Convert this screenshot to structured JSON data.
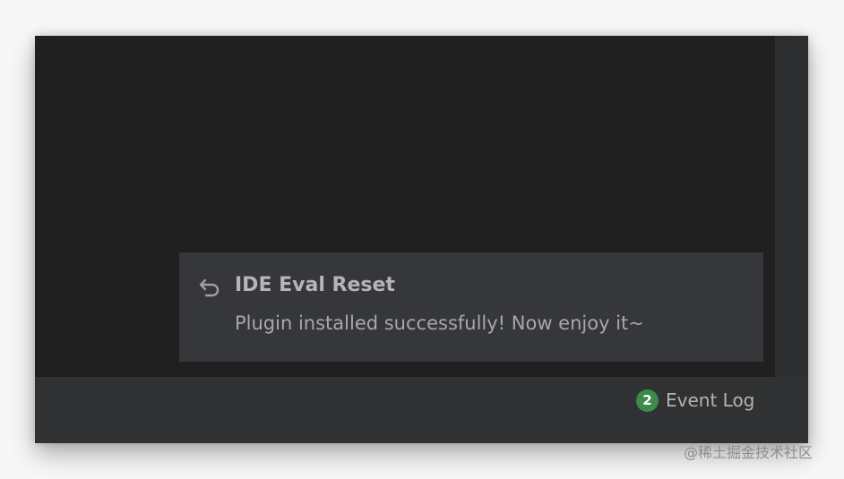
{
  "notification": {
    "icon": "undo-icon",
    "title": "IDE Eval Reset",
    "message": "Plugin installed successfully! Now enjoy it~"
  },
  "status_bar": {
    "event_log": {
      "count": "2",
      "label": "Event Log"
    }
  },
  "watermark": {
    "text": "@稀土掘金技术社区"
  },
  "colors": {
    "page_background": "#f7f7f7",
    "editor_background": "#202020",
    "notification_background": "#35373a",
    "status_bar_background": "#303133",
    "event_badge": "#3d8b4a",
    "primary_text": "#b5b5b5"
  }
}
